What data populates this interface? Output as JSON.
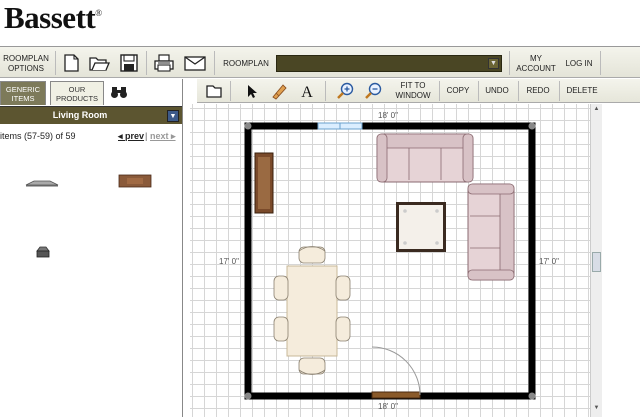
{
  "brand": {
    "name": "Bassett",
    "mark": "®"
  },
  "topbar": {
    "roomplan_options": "ROOMPLAN OPTIONS",
    "roomplan_label": "ROOMPLAN",
    "my_account": "MY ACCOUNT",
    "log_in": "LOG IN"
  },
  "left": {
    "tab_generic": "GENERIC ITEMS",
    "tab_ours": "OUR PRODUCTS",
    "category": "Living Room",
    "items_text": "items (57-59) of 59",
    "prev": "prev",
    "separator": "|",
    "next": "next"
  },
  "toolbar": {
    "fit_to_window": "FIT TO WINDOW",
    "copy": "COPY",
    "undo": "UNDO",
    "redo": "REDO",
    "delete": "DELETE"
  },
  "plan": {
    "dim_top": "18' 0\"",
    "dim_bottom": "18' 0\"",
    "dim_left": "17' 0\"",
    "dim_right": "17' 0\""
  },
  "colors": {
    "toolbar_bg": "#ecece2",
    "category_bar": "#5c5530",
    "tab_active": "#7d7a5a",
    "wall": "#000000",
    "sofa": "#e6d3d6",
    "table": "#f5ecdc",
    "wood": "#7a4a2a"
  }
}
